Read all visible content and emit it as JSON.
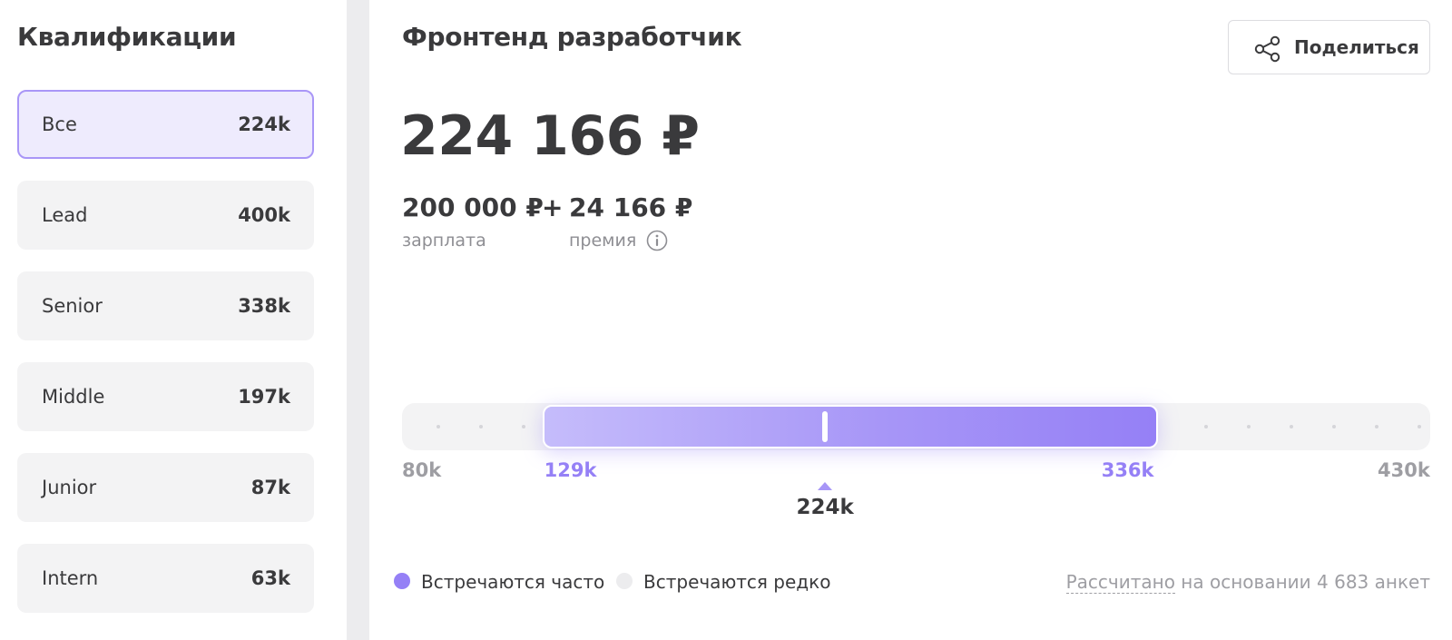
{
  "sidebar": {
    "title": "Квалификации",
    "levels": [
      {
        "name": "Все",
        "value": "224k",
        "active": true
      },
      {
        "name": "Lead",
        "value": "400k",
        "active": false
      },
      {
        "name": "Senior",
        "value": "338k",
        "active": false
      },
      {
        "name": "Middle",
        "value": "197k",
        "active": false
      },
      {
        "name": "Junior",
        "value": "87k",
        "active": false
      },
      {
        "name": "Intern",
        "value": "63k",
        "active": false
      }
    ]
  },
  "main": {
    "title": "Фронтенд разработчик",
    "share_label": "Поделиться",
    "total": "224 166 ₽",
    "salary": "200 000 ₽",
    "plus": "+",
    "bonus": "24 166 ₽",
    "salary_label": "зарплата",
    "bonus_label": "премия"
  },
  "range": {
    "min": 80,
    "max": 430,
    "low": 129,
    "high": 336,
    "median": 224,
    "min_label": "80k",
    "max_label": "430k",
    "low_label": "129k",
    "high_label": "336k",
    "median_label": "224k"
  },
  "legend": {
    "frequent": "Встречаются часто",
    "rare": "Встречаются редко",
    "frequent_color": "#9580f6",
    "rare_color": "#ececee"
  },
  "footer": {
    "calc_link": "Рассчитано",
    "calc_rest": " на основании 4 683 анкет"
  },
  "colors": {
    "accent": "#9580f6",
    "active_bg": "#eeebfd",
    "active_border": "#a996f7"
  }
}
